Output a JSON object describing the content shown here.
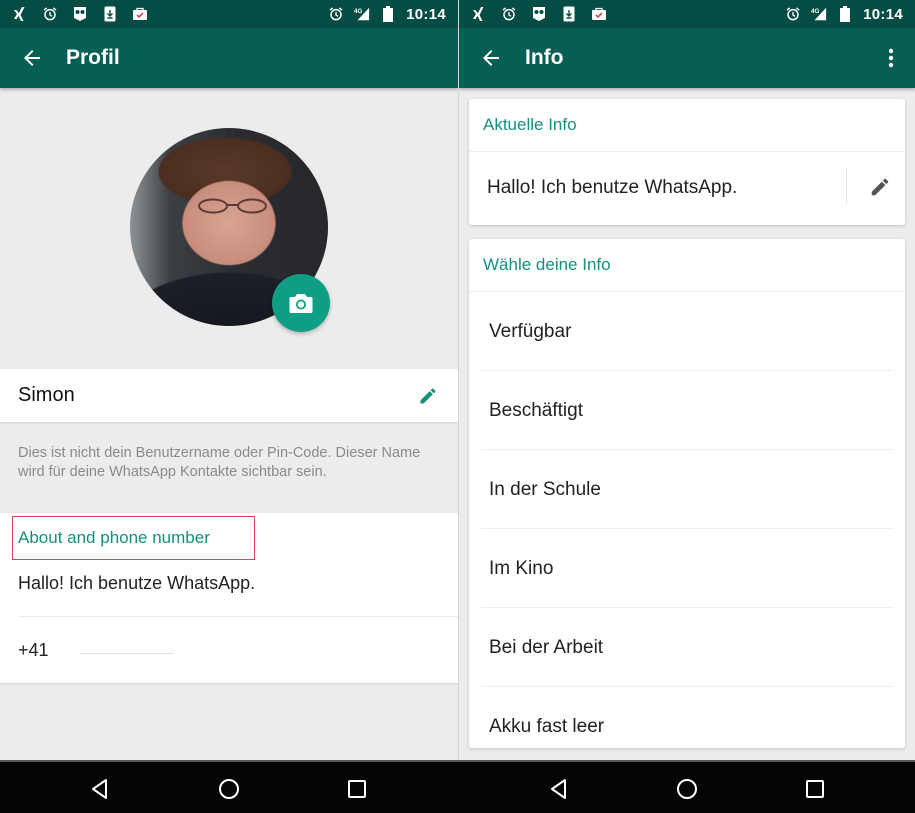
{
  "status_bar": {
    "time": "10:14",
    "network": "4G",
    "left_icons": [
      "xing-icon",
      "alarm-icon",
      "owl-icon",
      "download-icon",
      "briefcase-check-icon"
    ],
    "right_icons": [
      "alarm-icon",
      "signal-4g-icon",
      "battery-icon"
    ]
  },
  "colors": {
    "status_bar": "#054d44",
    "app_bar": "#075e54",
    "accent": "#13907e",
    "fab": "#0f9d85",
    "highlight_box": "#d2465d"
  },
  "profile_screen": {
    "title": "Profil",
    "back_icon": "arrow-left-icon",
    "camera_icon": "camera-icon",
    "name": "Simon",
    "edit_icon": "pencil-icon",
    "hint": "Dies ist nicht dein Benutzername oder Pin-Code. Dieser Name wird für deine WhatsApp Kontakte sichtbar sein.",
    "about_section_label": "About and phone number",
    "about_text": "Hallo! Ich benutze WhatsApp.",
    "phone_prefix": "+41"
  },
  "info_screen": {
    "title": "Info",
    "back_icon": "arrow-left-icon",
    "menu_icon": "more-vert-icon",
    "current_header": "Aktuelle Info",
    "current_text": "Hallo! Ich benutze WhatsApp.",
    "edit_icon": "pencil-icon",
    "choose_header": "Wähle deine Info",
    "options": [
      "Verfügbar",
      "Beschäftigt",
      "In der Schule",
      "Im Kino",
      "Bei der Arbeit",
      "Akku fast leer"
    ]
  },
  "nav_bar": {
    "buttons": [
      "back-triangle-icon",
      "home-circle-icon",
      "recents-square-icon"
    ]
  }
}
